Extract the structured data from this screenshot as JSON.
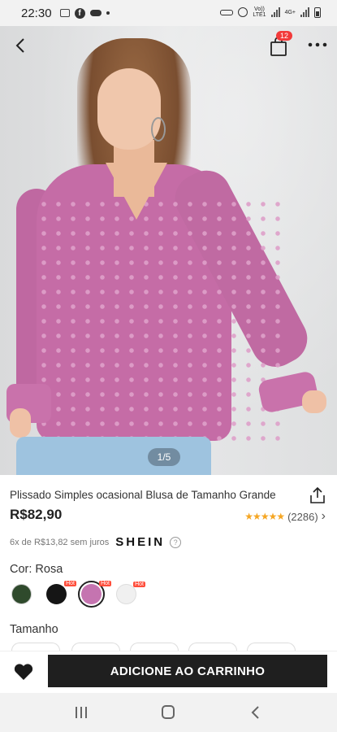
{
  "status_bar": {
    "time": "22:30",
    "network_top": "Vo))",
    "network_bottom": "LTE1",
    "signal_label": "4G+"
  },
  "header": {
    "cart_count": "12"
  },
  "gallery": {
    "pager": "1/5"
  },
  "product": {
    "title": "Plissado Simples ocasional Blusa de Tamanho Grande",
    "price": "R$82,90",
    "rating": 4.5,
    "review_count": "(2286)",
    "installments": "6x de R$13,82 sem juros",
    "brand": "SHEIN",
    "color_label": "Cor: Rosa",
    "swatches": [
      {
        "name": "verde",
        "color": "#2f4a2c",
        "hot": ""
      },
      {
        "name": "preto",
        "color": "#151515",
        "hot": "Hot"
      },
      {
        "name": "rosa",
        "color": "#c574b0",
        "hot": "Hot"
      },
      {
        "name": "branco",
        "color": "#f0f0f0",
        "hot": "Hot"
      }
    ],
    "size_label": "Tamanho"
  },
  "actions": {
    "add_to_cart": "ADICIONE AO CARRINHO"
  },
  "colors": {
    "accent_dark": "#1f1f1f",
    "badge_red": "#f23a3a",
    "star": "#f5a623"
  }
}
